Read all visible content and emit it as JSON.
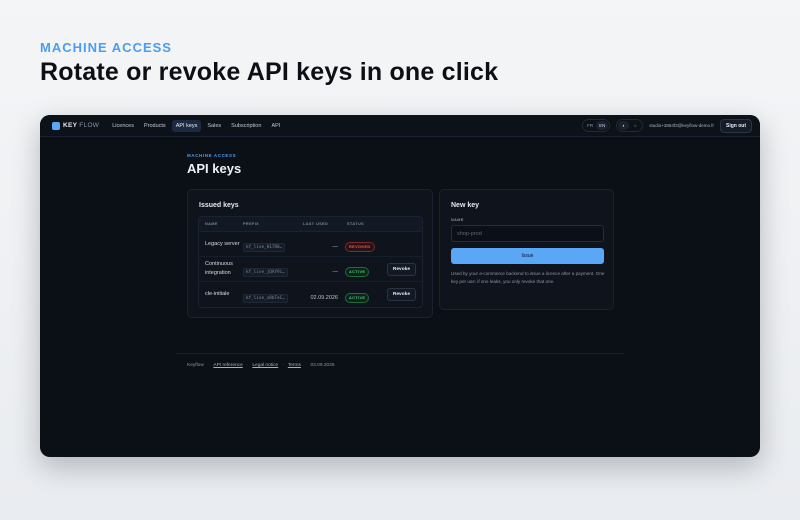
{
  "hero": {
    "eyebrow": "MACHINE ACCESS",
    "title": "Rotate or revoke API keys in one click"
  },
  "topbar": {
    "brand_primary": "KEY",
    "brand_secondary": "FLOW",
    "nav": [
      "Licences",
      "Products",
      "API keys",
      "Sales",
      "Subscription",
      "API"
    ],
    "active_nav": "API keys",
    "languages": [
      "FR",
      "EN"
    ],
    "theme": [
      "◐",
      "☼"
    ],
    "user_email": "studio+3864f3@keyflow-demo.fr",
    "sign_out": "Sign out"
  },
  "page": {
    "eyebrow": "MACHINE ACCESS",
    "title": "API keys"
  },
  "issued": {
    "title": "Issued keys",
    "columns": [
      "NAME",
      "PREFIX",
      "LAST USED",
      "STATUS"
    ],
    "rows": [
      {
        "name": "Legacy server",
        "prefix": "kf_live_H17R0…",
        "last_used": "—",
        "status": "REVOKED",
        "action": ""
      },
      {
        "name": "Continuous integration",
        "prefix": "kf_live_jQAY9i…",
        "last_used": "—",
        "status": "ACTIVE",
        "action": "Revoke"
      },
      {
        "name": "cle-initiale",
        "prefix": "kf_live_x8bTeC…",
        "last_used": "02.09.2026",
        "status": "ACTIVE",
        "action": "Revoke"
      }
    ]
  },
  "new_key": {
    "title": "New key",
    "field_label": "NAME",
    "placeholder": "shop-prod",
    "issue_label": "Issue",
    "help": "Used by your e-commerce backend to issue a licence after a payment. One key per use: if one leaks, you only revoke that one."
  },
  "footer": {
    "brand": "Keyflow",
    "links": [
      "API reference",
      "Legal notice",
      "Terms"
    ],
    "date": "03.09.2026"
  },
  "colors": {
    "accent": "#5aa8f5",
    "revoked": "#ef5b5b",
    "active": "#3fcf7a",
    "window_bg": "#0b0f16"
  }
}
